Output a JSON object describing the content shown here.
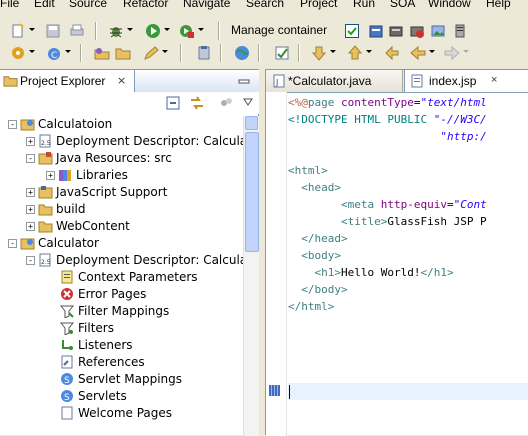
{
  "menubar": {
    "items": [
      "File",
      "Edit",
      "Source",
      "Refactor",
      "Navigate",
      "Search",
      "Project",
      "Run",
      "SOA",
      "Window",
      "Help"
    ]
  },
  "toolbar": {
    "manage_container_label": "Manage container",
    "manage_container_checked": true
  },
  "project_explorer": {
    "tab_label": "Project Explorer",
    "tab_close": "×",
    "tree": [
      {
        "label": "Calculatoion",
        "level": 0,
        "expand": "-",
        "icon": "web-project-icon"
      },
      {
        "label": "Deployment Descriptor: Calcula",
        "level": 1,
        "expand": "+",
        "icon": "deployment-descriptor-icon"
      },
      {
        "label": "Java Resources: src",
        "level": 1,
        "expand": "-",
        "icon": "java-resources-icon"
      },
      {
        "label": "Libraries",
        "level": 2,
        "expand": "+",
        "icon": "libraries-icon"
      },
      {
        "label": "JavaScript Support",
        "level": 1,
        "expand": "+",
        "icon": "javascript-support-icon"
      },
      {
        "label": "build",
        "level": 1,
        "expand": "+",
        "icon": "folder-icon"
      },
      {
        "label": "WebContent",
        "level": 1,
        "expand": "+",
        "icon": "folder-icon"
      },
      {
        "label": "Calculator",
        "level": 0,
        "expand": "-",
        "icon": "web-project-icon"
      },
      {
        "label": "Deployment Descriptor: Calcula",
        "level": 1,
        "expand": "-",
        "icon": "deployment-descriptor-icon"
      },
      {
        "label": "Context Parameters",
        "level": 2,
        "expand": "",
        "icon": "context-parameters-icon"
      },
      {
        "label": "Error Pages",
        "level": 2,
        "expand": "",
        "icon": "error-pages-icon"
      },
      {
        "label": "Filter Mappings",
        "level": 2,
        "expand": "",
        "icon": "filter-mappings-icon"
      },
      {
        "label": "Filters",
        "level": 2,
        "expand": "",
        "icon": "filters-icon"
      },
      {
        "label": "Listeners",
        "level": 2,
        "expand": "",
        "icon": "listeners-icon"
      },
      {
        "label": "References",
        "level": 2,
        "expand": "",
        "icon": "references-icon"
      },
      {
        "label": "Servlet Mappings",
        "level": 2,
        "expand": "",
        "icon": "servlet-mappings-icon"
      },
      {
        "label": "Servlets",
        "level": 2,
        "expand": "",
        "icon": "servlets-icon"
      },
      {
        "label": "Welcome Pages",
        "level": 2,
        "expand": "",
        "icon": "welcome-pages-icon"
      }
    ]
  },
  "editor": {
    "tabs": [
      {
        "label": "*Calculator.java",
        "active": false
      },
      {
        "label": "index.jsp",
        "active": true
      }
    ],
    "tab_close": "×",
    "code_lines": [
      [
        {
          "t": "<%@",
          "c": "dir"
        },
        {
          "t": "page ",
          "c": "tag"
        },
        {
          "t": "contentType",
          "c": "attr"
        },
        {
          "t": "=",
          "c": "txt"
        },
        {
          "t": "\"text/html",
          "c": "str"
        }
      ],
      [
        {
          "t": "<!DOCTYPE HTML PUBLIC ",
          "c": "gray"
        },
        {
          "t": "\"-//W3C/",
          "c": "str"
        }
      ],
      [
        {
          "t": "                       ",
          "c": "txt"
        },
        {
          "t": "\"http:/",
          "c": "str"
        }
      ],
      [
        {
          "t": "",
          "c": "txt"
        }
      ],
      [
        {
          "t": "<html>",
          "c": "tag"
        }
      ],
      [
        {
          "t": "  <head>",
          "c": "tag"
        }
      ],
      [
        {
          "t": "        <meta ",
          "c": "tag"
        },
        {
          "t": "http-equiv",
          "c": "attr"
        },
        {
          "t": "=",
          "c": "txt"
        },
        {
          "t": "\"Cont",
          "c": "str"
        }
      ],
      [
        {
          "t": "        <title>",
          "c": "tag"
        },
        {
          "t": "GlassFish JSP P",
          "c": "txt"
        }
      ],
      [
        {
          "t": "  </head>",
          "c": "tag"
        }
      ],
      [
        {
          "t": "  <body>",
          "c": "tag"
        }
      ],
      [
        {
          "t": "    <h1>",
          "c": "tag"
        },
        {
          "t": "Hello World!",
          "c": "txt"
        },
        {
          "t": "</h1>",
          "c": "tag"
        }
      ],
      [
        {
          "t": "  </body>",
          "c": "tag"
        }
      ],
      [
        {
          "t": "</html>",
          "c": "tag"
        }
      ],
      [
        {
          "t": "",
          "c": "txt"
        }
      ]
    ]
  }
}
